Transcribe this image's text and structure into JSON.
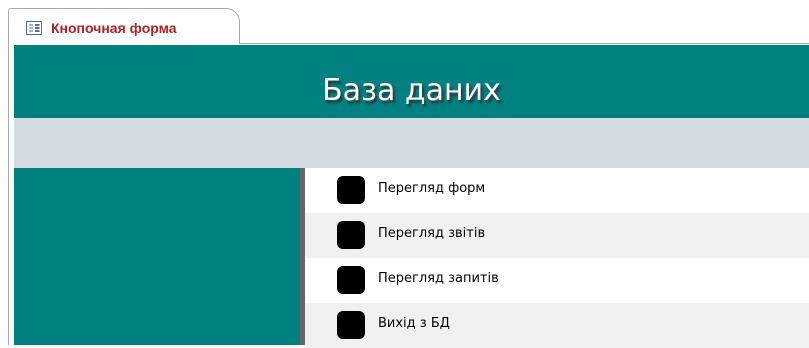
{
  "document_tab": {
    "label": "Кнопочная форма",
    "icon": "form-icon",
    "label_color": "#b22222"
  },
  "form": {
    "title": "База даних",
    "colors": {
      "header": "#008080",
      "band": "#d3dbe1",
      "side_panel": "#008080",
      "row_alt": "#f0f0f0"
    },
    "menu_items": [
      {
        "label": "Перегляд форм"
      },
      {
        "label": "Перегляд звітів"
      },
      {
        "label": "Перегляд запитів"
      },
      {
        "label": "Вихід з БД"
      }
    ]
  }
}
